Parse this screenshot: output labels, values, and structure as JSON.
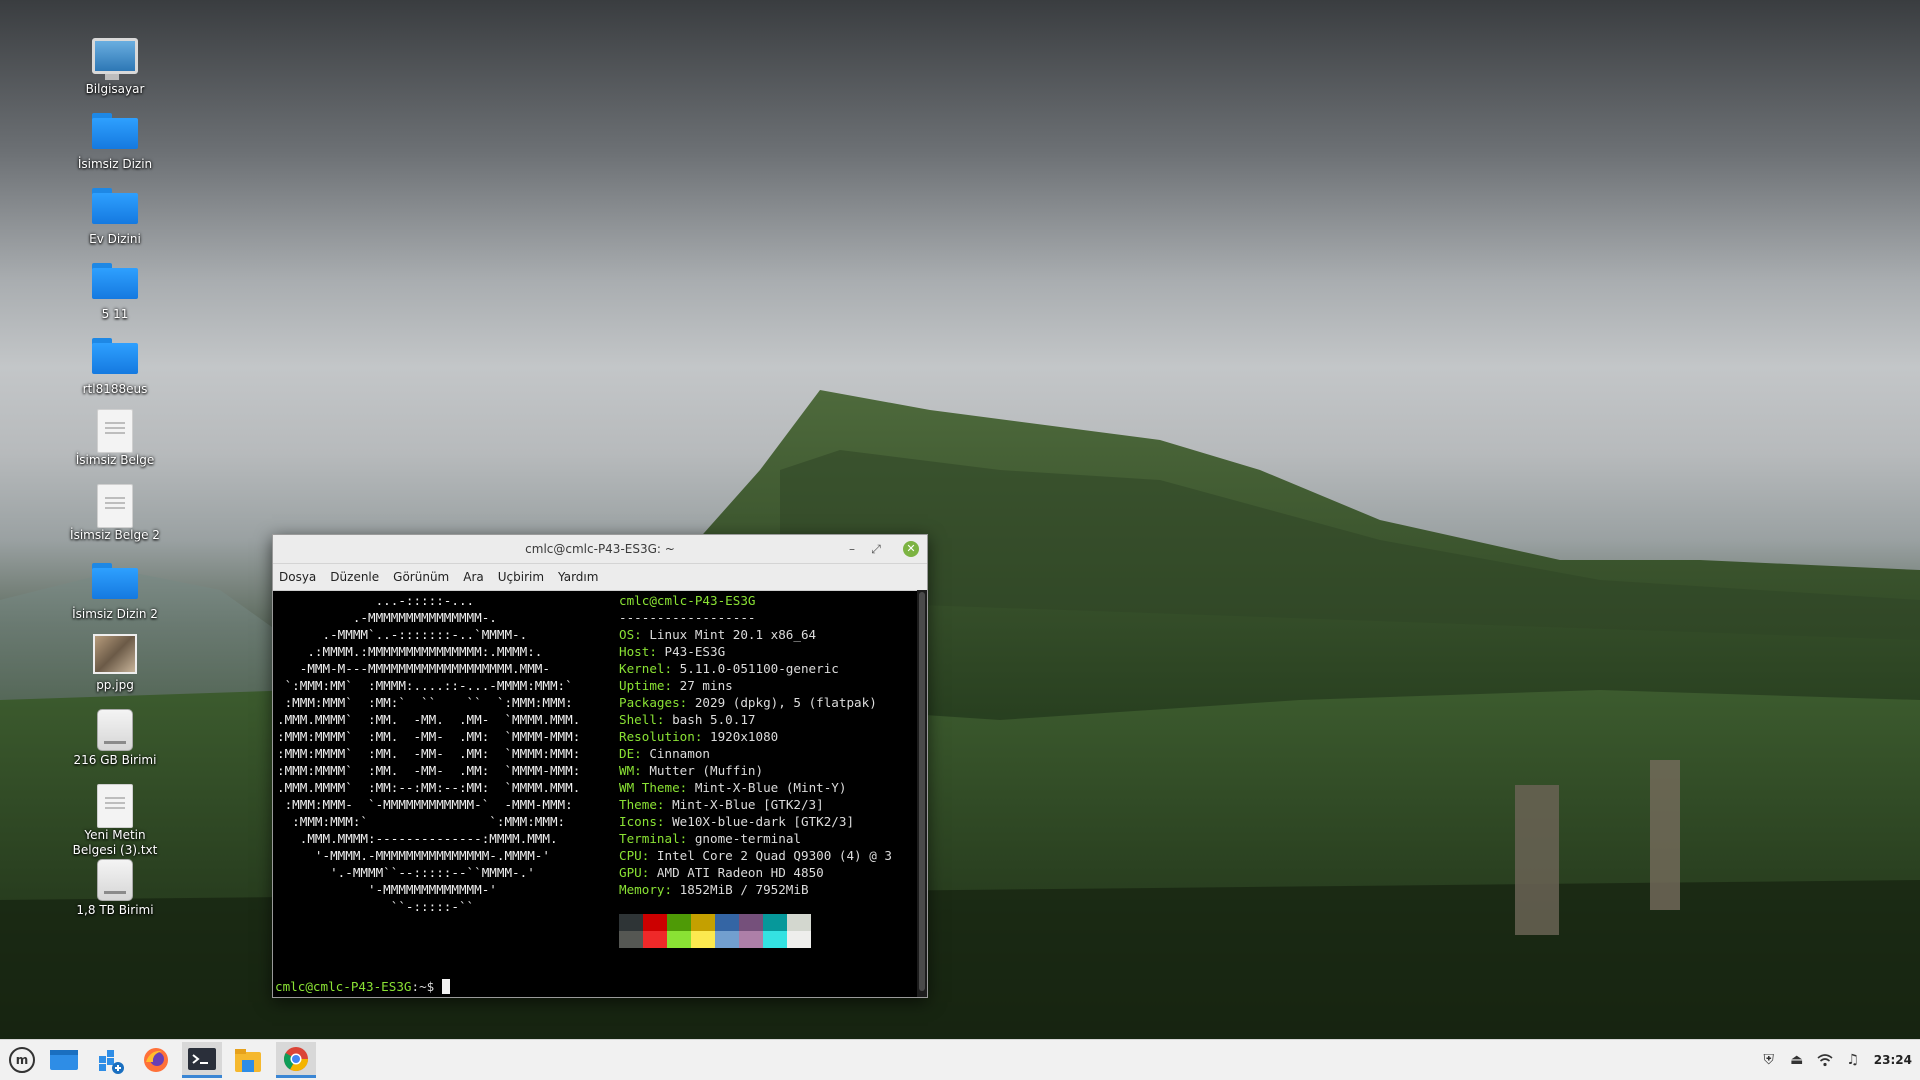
{
  "desktop": {
    "icons": [
      {
        "label": "Bilgisayar",
        "icon": "computer-icon"
      },
      {
        "label": "İsimsiz Dizin",
        "icon": "folder-icon"
      },
      {
        "label": "Ev Dizini",
        "icon": "home-folder-icon"
      },
      {
        "label": "5 11",
        "icon": "folder-icon"
      },
      {
        "label": "rtl8188eus",
        "icon": "folder-icon"
      },
      {
        "label": "İsimsiz Belge",
        "icon": "document-icon"
      },
      {
        "label": "İsimsiz Belge 2",
        "icon": "document-icon"
      },
      {
        "label": "İsimsiz Dizin 2",
        "icon": "folder-icon"
      },
      {
        "label": "pp.jpg",
        "icon": "image-icon"
      },
      {
        "label": "216 GB Birimi",
        "icon": "drive-icon"
      },
      {
        "label": "Yeni Metin Belgesi (3).txt",
        "icon": "document-icon"
      },
      {
        "label": "1,8 TB Birimi",
        "icon": "drive-icon"
      }
    ]
  },
  "terminal": {
    "title": "cmlc@cmlc-P43-ES3G: ~",
    "menu": [
      "Dosya",
      "Düzenle",
      "Görünüm",
      "Ara",
      "Uçbirim",
      "Yardım"
    ],
    "ascii_art": [
      "             ...-:::::-...",
      "          .-MMMMMMMMMMMMMMM-.",
      "      .-MMMM`..-:::::::-..`MMMM-.",
      "    .:MMMM.:MMMMMMMMMMMMMMM:.MMMM:.",
      "   -MMM-M---MMMMMMMMMMMMMMMMMMM.MMM-",
      " `:MMM:MM`  :MMMM:....::-...-MMMM:MMM:`",
      " :MMM:MMM`  :MM:`  ``    ``  `:MMM:MMM:",
      ".MMM.MMMM`  :MM.  -MM.  .MM-  `MMMM.MMM.",
      ":MMM:MMMM`  :MM.  -MM-  .MM:  `MMMM-MMM:",
      ":MMM:MMMM`  :MM.  -MM-  .MM:  `MMMM:MMM:",
      ":MMM:MMMM`  :MM.  -MM-  .MM:  `MMMM-MMM:",
      ".MMM.MMMM`  :MM:--:MM:--:MM:  `MMMM.MMM.",
      " :MMM:MMM-  `-MMMMMMMMMMMM-`  -MMM-MMM:",
      "  :MMM:MMM:`                `:MMM:MMM:",
      "   .MMM.MMMM:--------------:MMMM.MMM.",
      "     '-MMMM.-MMMMMMMMMMMMMMM-.MMMM-'",
      "       '.-MMMM``--:::::--``MMMM-.'",
      "            '-MMMMMMMMMMMMM-'",
      "               ``-:::::-``"
    ],
    "user_host": "cmlc@cmlc-P43-ES3G",
    "separator": "------------------",
    "info": [
      {
        "key": "OS",
        "value": "Linux Mint 20.1 x86_64"
      },
      {
        "key": "Host",
        "value": "P43-ES3G"
      },
      {
        "key": "Kernel",
        "value": "5.11.0-051100-generic"
      },
      {
        "key": "Uptime",
        "value": "27 mins"
      },
      {
        "key": "Packages",
        "value": "2029 (dpkg), 5 (flatpak)"
      },
      {
        "key": "Shell",
        "value": "bash 5.0.17"
      },
      {
        "key": "Resolution",
        "value": "1920x1080"
      },
      {
        "key": "DE",
        "value": "Cinnamon"
      },
      {
        "key": "WM",
        "value": "Mutter (Muffin)"
      },
      {
        "key": "WM Theme",
        "value": "Mint-X-Blue (Mint-Y)"
      },
      {
        "key": "Theme",
        "value": "Mint-X-Blue [GTK2/3]"
      },
      {
        "key": "Icons",
        "value": "We10X-blue-dark [GTK2/3]"
      },
      {
        "key": "Terminal",
        "value": "gnome-terminal"
      },
      {
        "key": "CPU",
        "value": "Intel Core 2 Quad Q9300 (4) @ 3"
      },
      {
        "key": "GPU",
        "value": "AMD ATI Radeon HD 4850"
      },
      {
        "key": "Memory",
        "value": "1852MiB / 7952MiB"
      }
    ],
    "palette_top": [
      "#2e3436",
      "#cc0000",
      "#4e9a06",
      "#c4a000",
      "#3465a4",
      "#75507b",
      "#06989a",
      "#d3d7cf"
    ],
    "palette_bottom": [
      "#555753",
      "#ef2929",
      "#8ae234",
      "#fce94f",
      "#729fcf",
      "#ad7fa8",
      "#34e2e2",
      "#eeeeec"
    ],
    "prompt": "cmlc@cmlc-P43-ES3G",
    "prompt_suffix": ":~$ "
  },
  "taskbar": {
    "apps": [
      "mint-menu-icon",
      "show-desktop-icon",
      "software-manager-icon",
      "firefox-icon",
      "terminal-icon",
      "file-manager-icon",
      "chrome-icon"
    ],
    "clock": "23:24"
  }
}
